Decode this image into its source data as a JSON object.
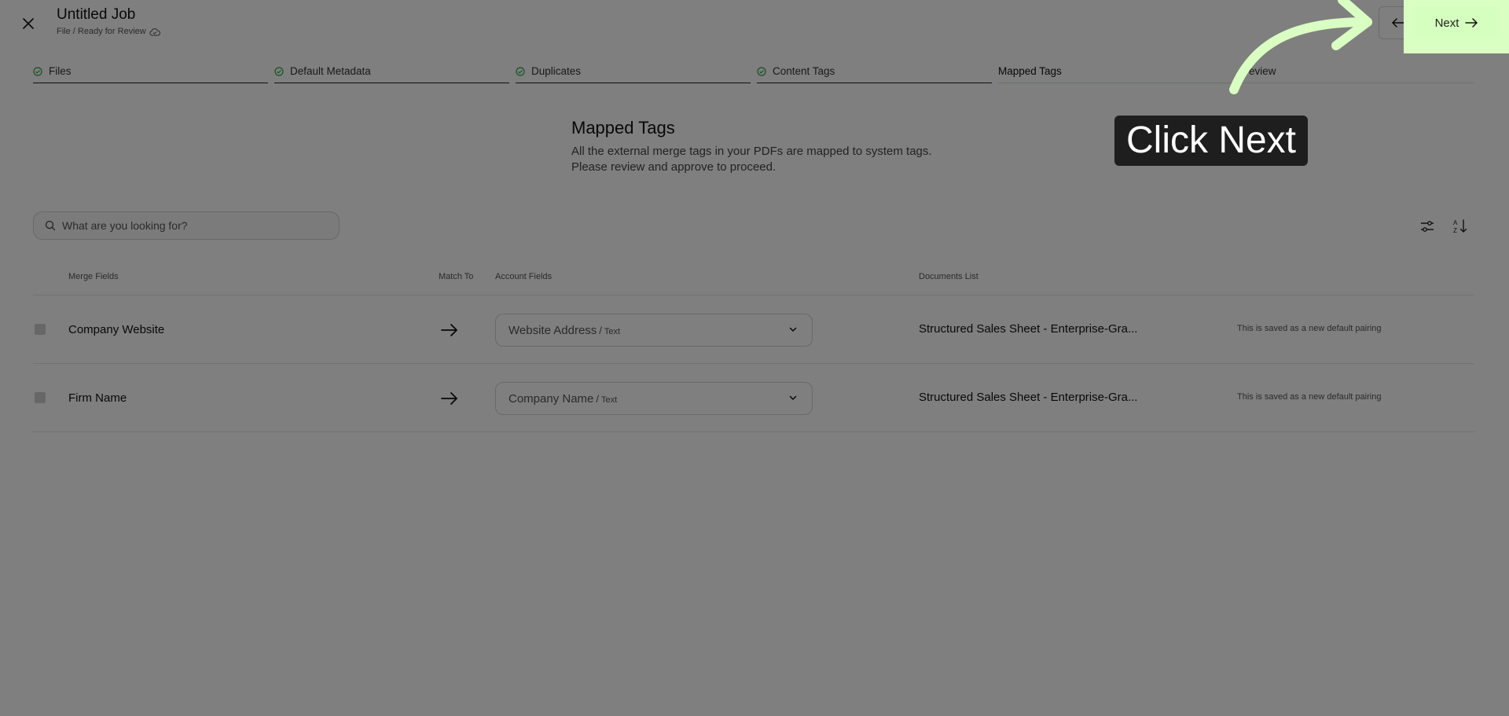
{
  "header": {
    "title": "Untitled Job",
    "breadcrumb": "File / Ready for Review",
    "next_label": "Next"
  },
  "steps": [
    {
      "label": "Files",
      "status": "done"
    },
    {
      "label": "Default Metadata",
      "status": "done"
    },
    {
      "label": "Duplicates",
      "status": "done"
    },
    {
      "label": "Content Tags",
      "status": "done"
    },
    {
      "label": "Mapped Tags",
      "status": "current"
    },
    {
      "label": "eview",
      "status": "upcoming"
    }
  ],
  "section": {
    "title": "Mapped Tags",
    "desc_line1": "All the external merge tags in your PDFs are mapped to system tags.",
    "desc_line2": "Please review and approve to proceed."
  },
  "search": {
    "placeholder": "What are you looking for?"
  },
  "table": {
    "headers": {
      "merge_fields": "Merge Fields",
      "match_to": "Match To",
      "account_fields": "Account Fields",
      "documents_list": "Documents List"
    },
    "rows": [
      {
        "merge_field": "Company Website",
        "account_field": "Website Address",
        "account_type": "Text",
        "document": "Structured Sales Sheet - Enterprise-Gra...",
        "note": "This is saved as a new default pairing"
      },
      {
        "merge_field": "Firm Name",
        "account_field": "Company Name",
        "account_type": "Text",
        "document": "Structured Sales Sheet - Enterprise-Gra...",
        "note": "This is saved as a new default pairing"
      }
    ]
  },
  "overlay": {
    "tooltip": "Click Next",
    "highlight_color": "#d4ffbf",
    "dim_color": "rgba(0,0,0,0.5)"
  },
  "icons": {
    "close": "close-icon",
    "cloud": "cloud-check-icon",
    "back": "arrow-left-icon",
    "next": "arrow-right-icon",
    "step_done": "check-circle-icon",
    "search": "search-icon",
    "filter": "sliders-icon",
    "sort": "sort-az-icon",
    "match": "arrow-right-icon",
    "dropdown": "chevron-down-icon"
  }
}
